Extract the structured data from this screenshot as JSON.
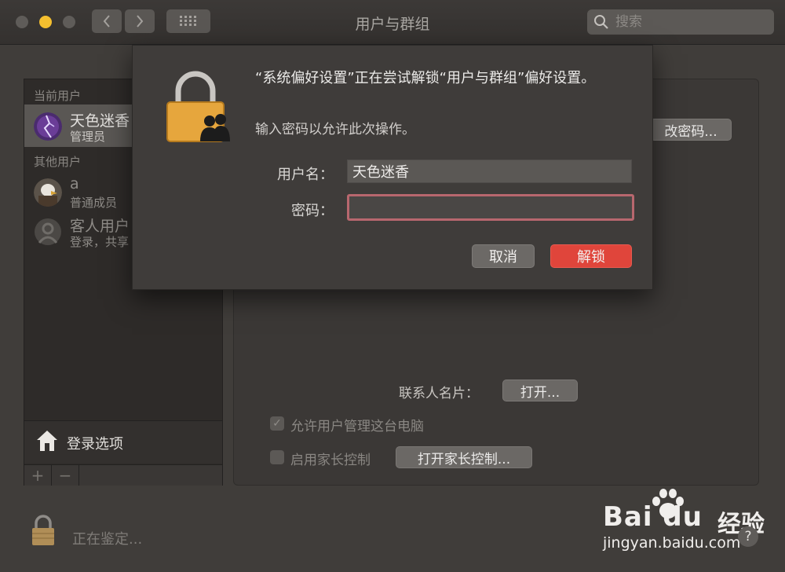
{
  "window": {
    "title": "用户与群组",
    "search_placeholder": "搜索"
  },
  "sidebar": {
    "current_users_label": "当前用户",
    "other_users_label": "其他用户",
    "current_user": {
      "name": "天色迷香",
      "role": "管理员"
    },
    "other_users": [
      {
        "name": "a",
        "role": "普通成员"
      },
      {
        "name": "客人用户",
        "role": "登录，共享"
      }
    ],
    "login_options_label": "登录选项",
    "add_label": "+",
    "remove_label": "−"
  },
  "panel": {
    "change_password_label": "改密码...",
    "contact_card_label": "联系人名片：",
    "open_label": "打开...",
    "allow_admin_label": "允许用户管理这台电脑",
    "allow_admin_checked": true,
    "parental_control_label": "启用家长控制",
    "parental_control_checked": false,
    "open_parental_label": "打开家长控制..."
  },
  "status": {
    "text": "正在鉴定..."
  },
  "dialog": {
    "message": "“系统偏好设置”正在尝试解锁“用户与群组”偏好设置。",
    "sub": "输入密码以允许此次操作。",
    "username_label": "用户名：",
    "username_value": "天色迷香",
    "password_label": "密码：",
    "password_value": "",
    "cancel_label": "取消",
    "unlock_label": "解锁",
    "unlock_color": "#e0453b"
  },
  "watermark": {
    "brand": "Bai du",
    "jingyan": "经验",
    "url": "jingyan.baidu.com"
  },
  "help_label": "?"
}
